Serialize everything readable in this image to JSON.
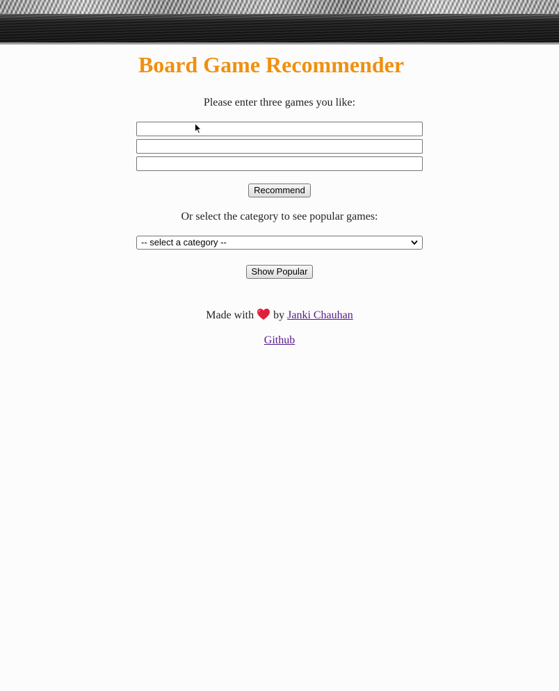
{
  "header": {
    "banner_alt": "board game banner"
  },
  "main": {
    "title": "Board Game Recommender",
    "prompt": "Please enter three games you like:",
    "inputs": [
      {
        "value": "",
        "placeholder": ""
      },
      {
        "value": "",
        "placeholder": ""
      },
      {
        "value": "",
        "placeholder": ""
      }
    ],
    "recommend_label": "Recommend",
    "category_prompt": "Or select the category to see popular games:",
    "category_select": {
      "selected": "-- select a category --"
    },
    "show_popular_label": "Show Popular"
  },
  "footer": {
    "made_with": "Made with",
    "by": "by",
    "author_link": "Janki Chauhan",
    "github_link": "Github"
  },
  "colors": {
    "title": "#f0900f",
    "link": "#551a8b",
    "heart": "#e0203a"
  },
  "icons": {
    "heart": "heart-icon",
    "select_arrow": "chevron-down-icon",
    "cursor": "mouse-cursor-icon"
  }
}
